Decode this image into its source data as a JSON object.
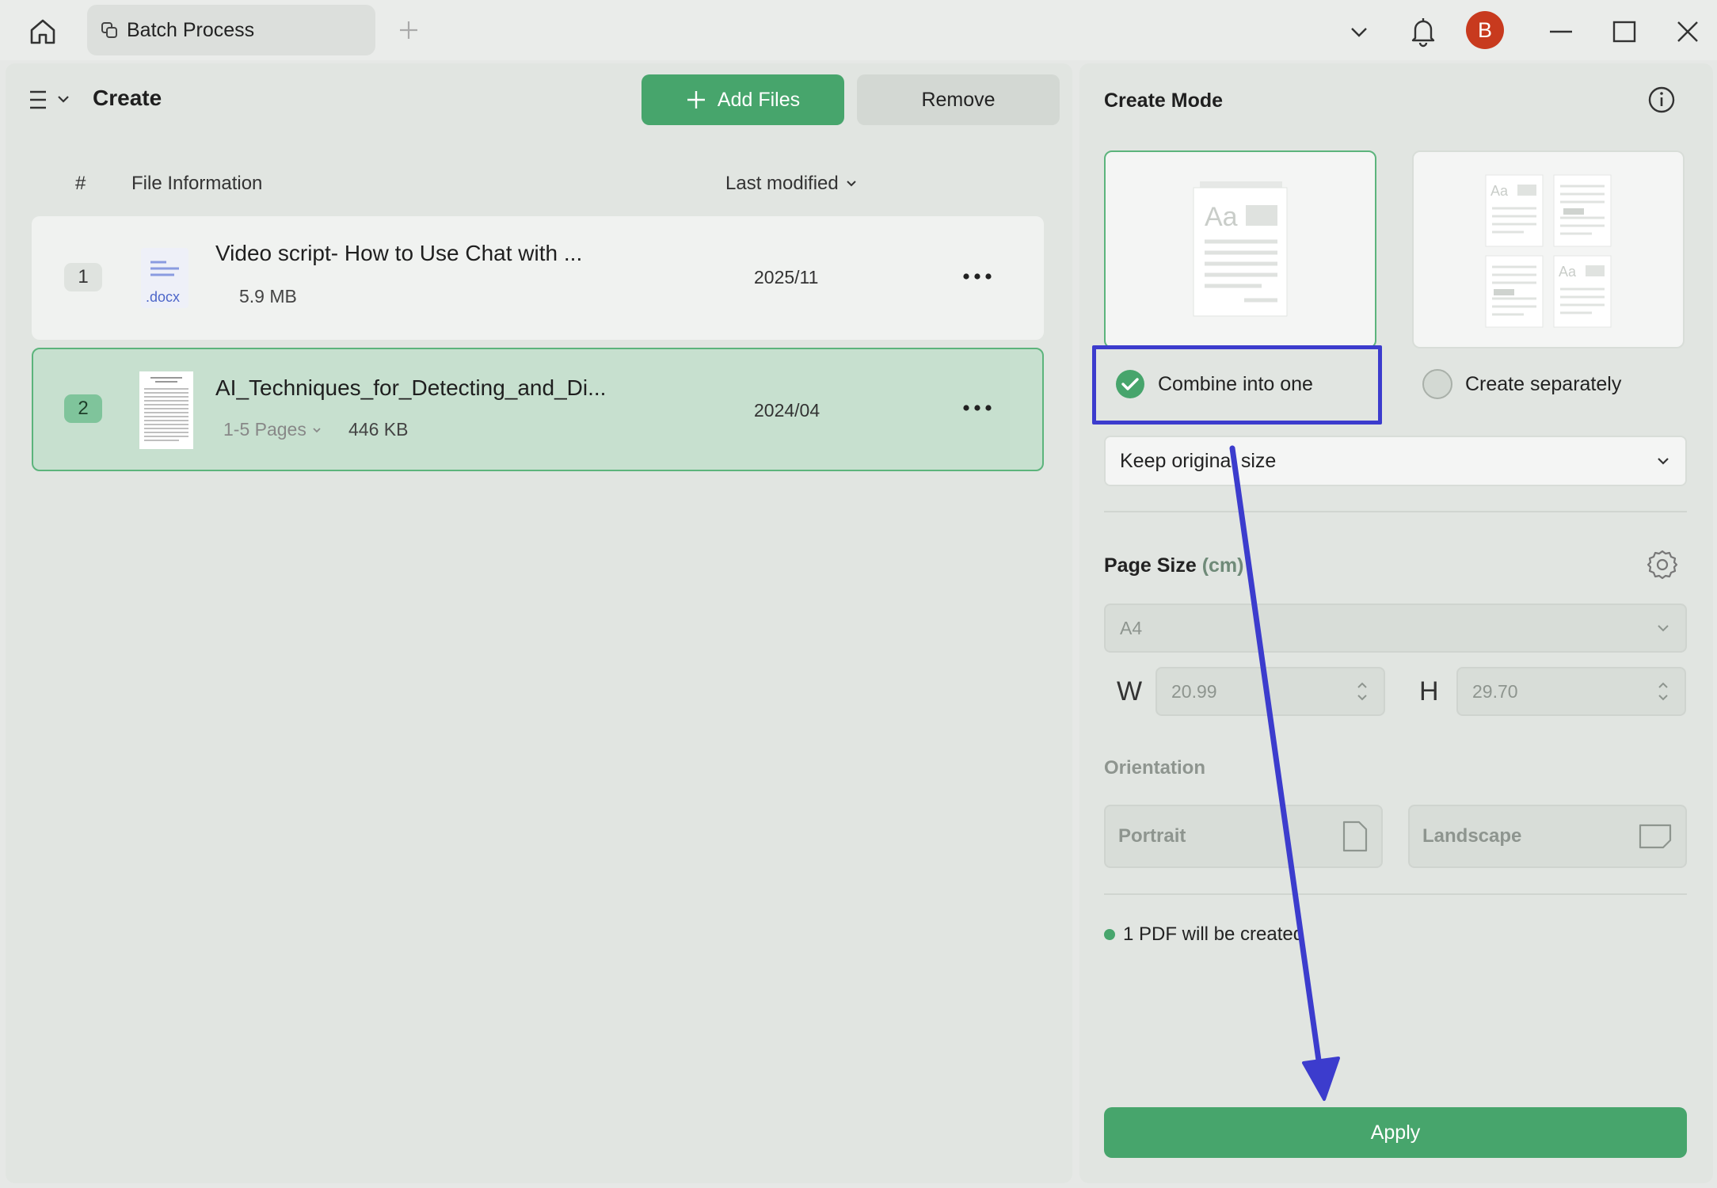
{
  "titlebar": {
    "tab_label": "Batch Process",
    "avatar_initial": "B"
  },
  "left": {
    "title": "Create",
    "add_files_label": "Add Files",
    "remove_label": "Remove",
    "columns": {
      "number": "#",
      "info": "File Information",
      "modified": "Last modified"
    },
    "files": [
      {
        "index": "1",
        "name": "Video script- How to Use Chat with ...",
        "ext": ".docx",
        "size": "5.9 MB",
        "modified": "2025/11"
      },
      {
        "index": "2",
        "name": "AI_Techniques_for_Detecting_and_Di...",
        "pages": "1-5 Pages",
        "size": "446 KB",
        "modified": "2024/04"
      }
    ]
  },
  "right": {
    "mode_title": "Create Mode",
    "combine_label": "Combine into one",
    "separate_label": "Create separately",
    "size_option": "Keep original size",
    "page_size_label": "Page Size",
    "page_size_unit": "(cm)",
    "paper": "A4",
    "width_label": "W",
    "width_value": "20.99",
    "height_label": "H",
    "height_value": "29.70",
    "orientation_label": "Orientation",
    "portrait_label": "Portrait",
    "landscape_label": "Landscape",
    "pdf_note": "1 PDF will be created",
    "apply_label": "Apply"
  },
  "colors": {
    "accent": "#47a56c",
    "annotation": "#3c3ccd",
    "avatar": "#c83a1e"
  }
}
